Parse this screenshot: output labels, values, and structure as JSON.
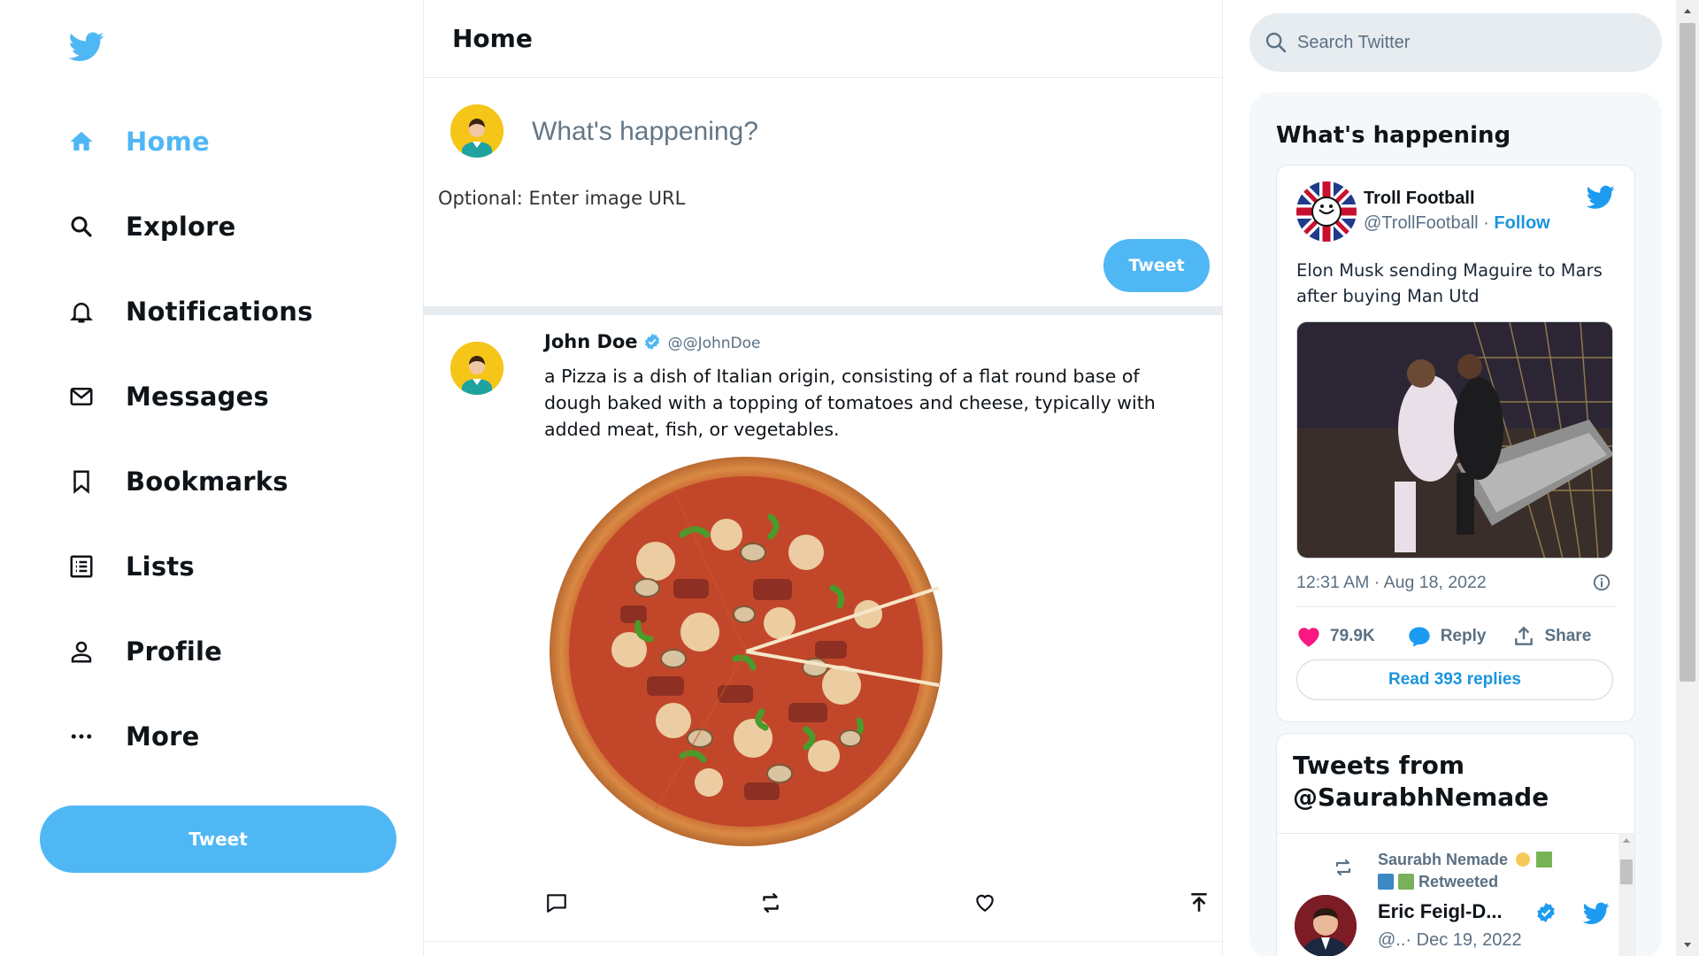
{
  "sidebar": {
    "logo_icon": "twitter-bird-icon",
    "items": [
      {
        "label": "Home",
        "icon": "home-icon"
      },
      {
        "label": "Explore",
        "icon": "search-icon"
      },
      {
        "label": "Notifications",
        "icon": "bell-icon"
      },
      {
        "label": "Messages",
        "icon": "mail-icon"
      },
      {
        "label": "Bookmarks",
        "icon": "bookmark-icon"
      },
      {
        "label": "Lists",
        "icon": "list-icon"
      },
      {
        "label": "Profile",
        "icon": "person-icon"
      },
      {
        "label": "More",
        "icon": "more-icon"
      }
    ],
    "tweet_button": "Tweet"
  },
  "feed": {
    "title": "Home",
    "composer": {
      "placeholder": "What's happening?",
      "image_placeholder": "Optional: Enter image URL",
      "tweet_button": "Tweet"
    },
    "post": {
      "name": "John Doe",
      "handle": "@@JohnDoe",
      "text": "a Pizza is a dish of Italian origin, consisting of a flat round base of dough baked with a topping of tomatoes and cheese, typically with added meat, fish, or vegetables.",
      "actions": [
        "comment-icon",
        "retweet-icon",
        "heart-icon",
        "share-icon"
      ]
    }
  },
  "right": {
    "search_placeholder": "Search Twitter",
    "panel_title": "What's happening",
    "embed": {
      "name": "Troll Football",
      "handle": "@TrollFootball",
      "separator": " · ",
      "follow": "Follow",
      "text": "Elon Musk sending Maguire to Mars after buying Man Utd",
      "timestamp": "12:31 AM · Aug 18, 2022",
      "likes": "79.9K",
      "reply": "Reply",
      "share": "Share",
      "read_replies": "Read 393 replies"
    },
    "timeline": {
      "title": "Tweets from @SaurabhNemade",
      "retweeter": "Saurabh Nemade",
      "retweeted": "Retweeted",
      "name": "Eric Feigl-D...",
      "meta": "@..· Dec 19, 2022"
    }
  },
  "colors": {
    "accent": "#50b7f5",
    "link": "#1b95e0",
    "like": "#f91880",
    "muted": "#5b7083"
  }
}
